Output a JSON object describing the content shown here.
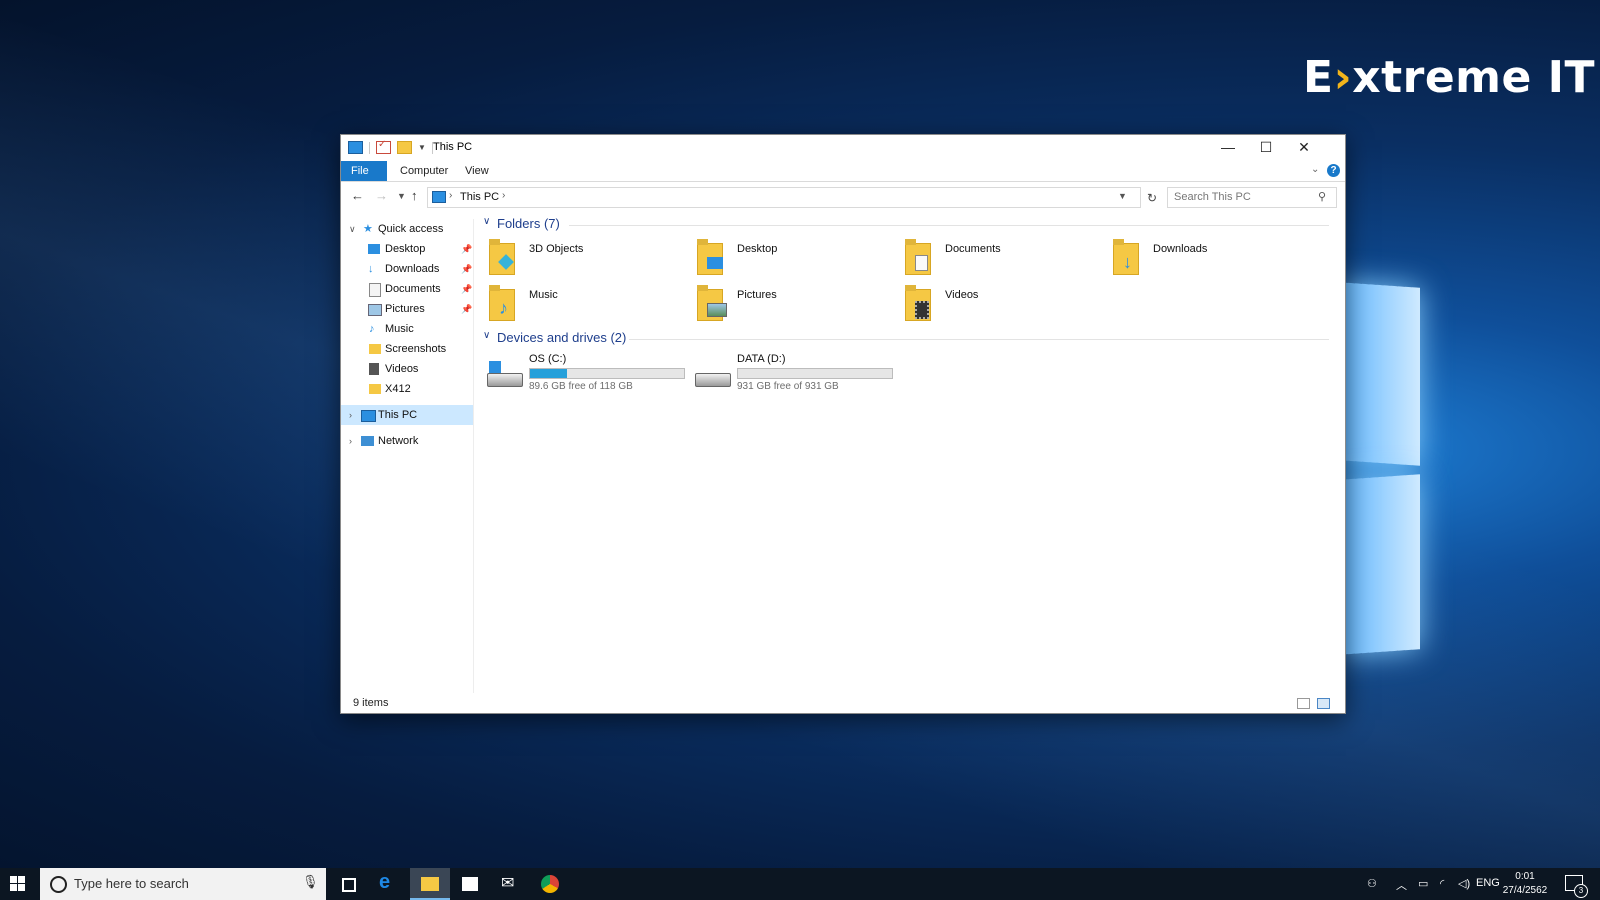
{
  "brand": {
    "prefix": "E",
    "arrow": "›",
    "rest": "xtreme IT"
  },
  "window": {
    "title": "This PC",
    "ribbon_tabs": {
      "file": "File",
      "computer": "Computer",
      "view": "View"
    },
    "help": "?",
    "address": {
      "location": "This PC"
    },
    "search_placeholder": "Search This PC",
    "status": "9 items"
  },
  "sidebar": {
    "quick_access": "Quick access",
    "items": [
      {
        "label": "Desktop",
        "pinned": true
      },
      {
        "label": "Downloads",
        "pinned": true
      },
      {
        "label": "Documents",
        "pinned": true
      },
      {
        "label": "Pictures",
        "pinned": true
      },
      {
        "label": "Music",
        "pinned": false
      },
      {
        "label": "Screenshots",
        "pinned": false
      },
      {
        "label": "Videos",
        "pinned": false
      },
      {
        "label": "X412",
        "pinned": false
      }
    ],
    "this_pc": "This PC",
    "network": "Network"
  },
  "folders": {
    "heading": "Folders (7)",
    "items": [
      "3D Objects",
      "Desktop",
      "Documents",
      "Downloads",
      "Music",
      "Pictures",
      "Videos"
    ]
  },
  "drives": {
    "heading": "Devices and drives (2)",
    "items": [
      {
        "name": "OS (C:)",
        "free": "89.6 GB free of 118 GB",
        "used_fraction": 0.24
      },
      {
        "name": "DATA (D:)",
        "free": "931 GB free of 931 GB",
        "used_fraction": 0.0
      }
    ]
  },
  "taskbar": {
    "search_placeholder": "Type here to search",
    "language": "ENG",
    "time": "0:01",
    "date": "27/4/2562",
    "notifications": "3"
  },
  "colors": {
    "accent": "#1979ca",
    "drive_fill": "#26a0da",
    "group_heading": "#1e3e8c",
    "brand_arrow": "#f2b41b"
  }
}
